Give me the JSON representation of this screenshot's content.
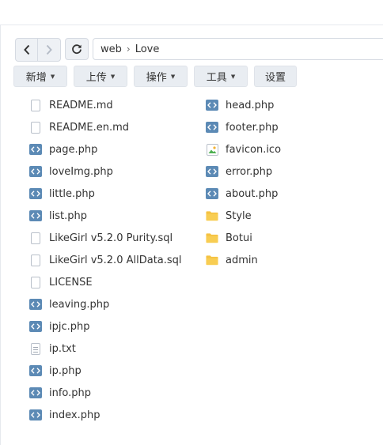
{
  "navigation": {
    "back_icon": "chevron-left",
    "forward_icon": "chevron-right",
    "refresh_icon": "refresh",
    "breadcrumb": [
      "web",
      "Love"
    ]
  },
  "toolbar": {
    "buttons": [
      {
        "label": "新增"
      },
      {
        "label": "上传"
      },
      {
        "label": "操作"
      },
      {
        "label": "工具"
      },
      {
        "label": "设置"
      }
    ]
  },
  "files": {
    "column1": [
      {
        "name": "README.md",
        "icon": "document"
      },
      {
        "name": "README.en.md",
        "icon": "document"
      },
      {
        "name": "page.php",
        "icon": "code"
      },
      {
        "name": "loveImg.php",
        "icon": "code"
      },
      {
        "name": "little.php",
        "icon": "code"
      },
      {
        "name": "list.php",
        "icon": "code"
      },
      {
        "name": "LikeGirl v5.2.0 Purity.sql",
        "icon": "document"
      },
      {
        "name": "LikeGirl v5.2.0 AllData.sql",
        "icon": "document"
      },
      {
        "name": "LICENSE",
        "icon": "document"
      },
      {
        "name": "leaving.php",
        "icon": "code"
      },
      {
        "name": "ipjc.php",
        "icon": "code"
      },
      {
        "name": "ip.txt",
        "icon": "text"
      },
      {
        "name": "ip.php",
        "icon": "code"
      },
      {
        "name": "info.php",
        "icon": "code"
      },
      {
        "name": "index.php",
        "icon": "code"
      }
    ],
    "column2": [
      {
        "name": "head.php",
        "icon": "code"
      },
      {
        "name": "footer.php",
        "icon": "code"
      },
      {
        "name": "favicon.ico",
        "icon": "image"
      },
      {
        "name": "error.php",
        "icon": "code"
      },
      {
        "name": "about.php",
        "icon": "code"
      },
      {
        "name": "Style",
        "icon": "folder"
      },
      {
        "name": "Botui",
        "icon": "folder"
      },
      {
        "name": "admin",
        "icon": "folder"
      }
    ]
  },
  "colors": {
    "code_icon": "#5c8ab5",
    "folder_icon": "#f5c242",
    "toolbar_button": "#e9edf2"
  }
}
